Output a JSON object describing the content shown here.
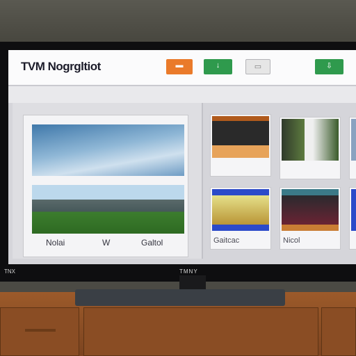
{
  "window": {
    "title": "TVM Nogrgltiot"
  },
  "header": {
    "logo_text": "TVM Nogrgltiot",
    "buttons": [
      {
        "name": "orange-button",
        "glyph": "▬",
        "color": "#ea7a2a"
      },
      {
        "name": "green-button",
        "glyph": "↓",
        "color": "#2f9a4d"
      },
      {
        "name": "gray-button",
        "glyph": "▭",
        "color": "#e6e6e6"
      },
      {
        "name": "green-button-right",
        "glyph": "⇩",
        "color": "#2f9a4d"
      }
    ]
  },
  "featured": {
    "captions": [
      "Nolai",
      "W",
      "Galtol"
    ]
  },
  "tiles": [
    {
      "label": ""
    },
    {
      "label": ""
    },
    {
      "label": ""
    },
    {
      "label": "Gaitcac"
    },
    {
      "label": "Nicol"
    },
    {
      "label": ""
    }
  ],
  "tv": {
    "brand": "TMNY",
    "badge": "TNX"
  }
}
